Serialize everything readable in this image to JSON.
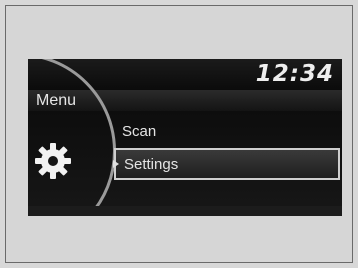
{
  "status_bar": {
    "clock": "12:34"
  },
  "header": {
    "title": "Menu"
  },
  "menu": {
    "items": [
      {
        "label": "Scan",
        "selected": false
      },
      {
        "label": "Settings",
        "selected": true
      }
    ]
  },
  "icons": {
    "category": "gear-icon",
    "selection_cursor": "triangle-right-icon"
  },
  "colors": {
    "screen_background": "#0f0f0f",
    "text": "#e4e4e4",
    "highlight_border": "#cfcfcf",
    "page_background": "#d8d8d8"
  }
}
